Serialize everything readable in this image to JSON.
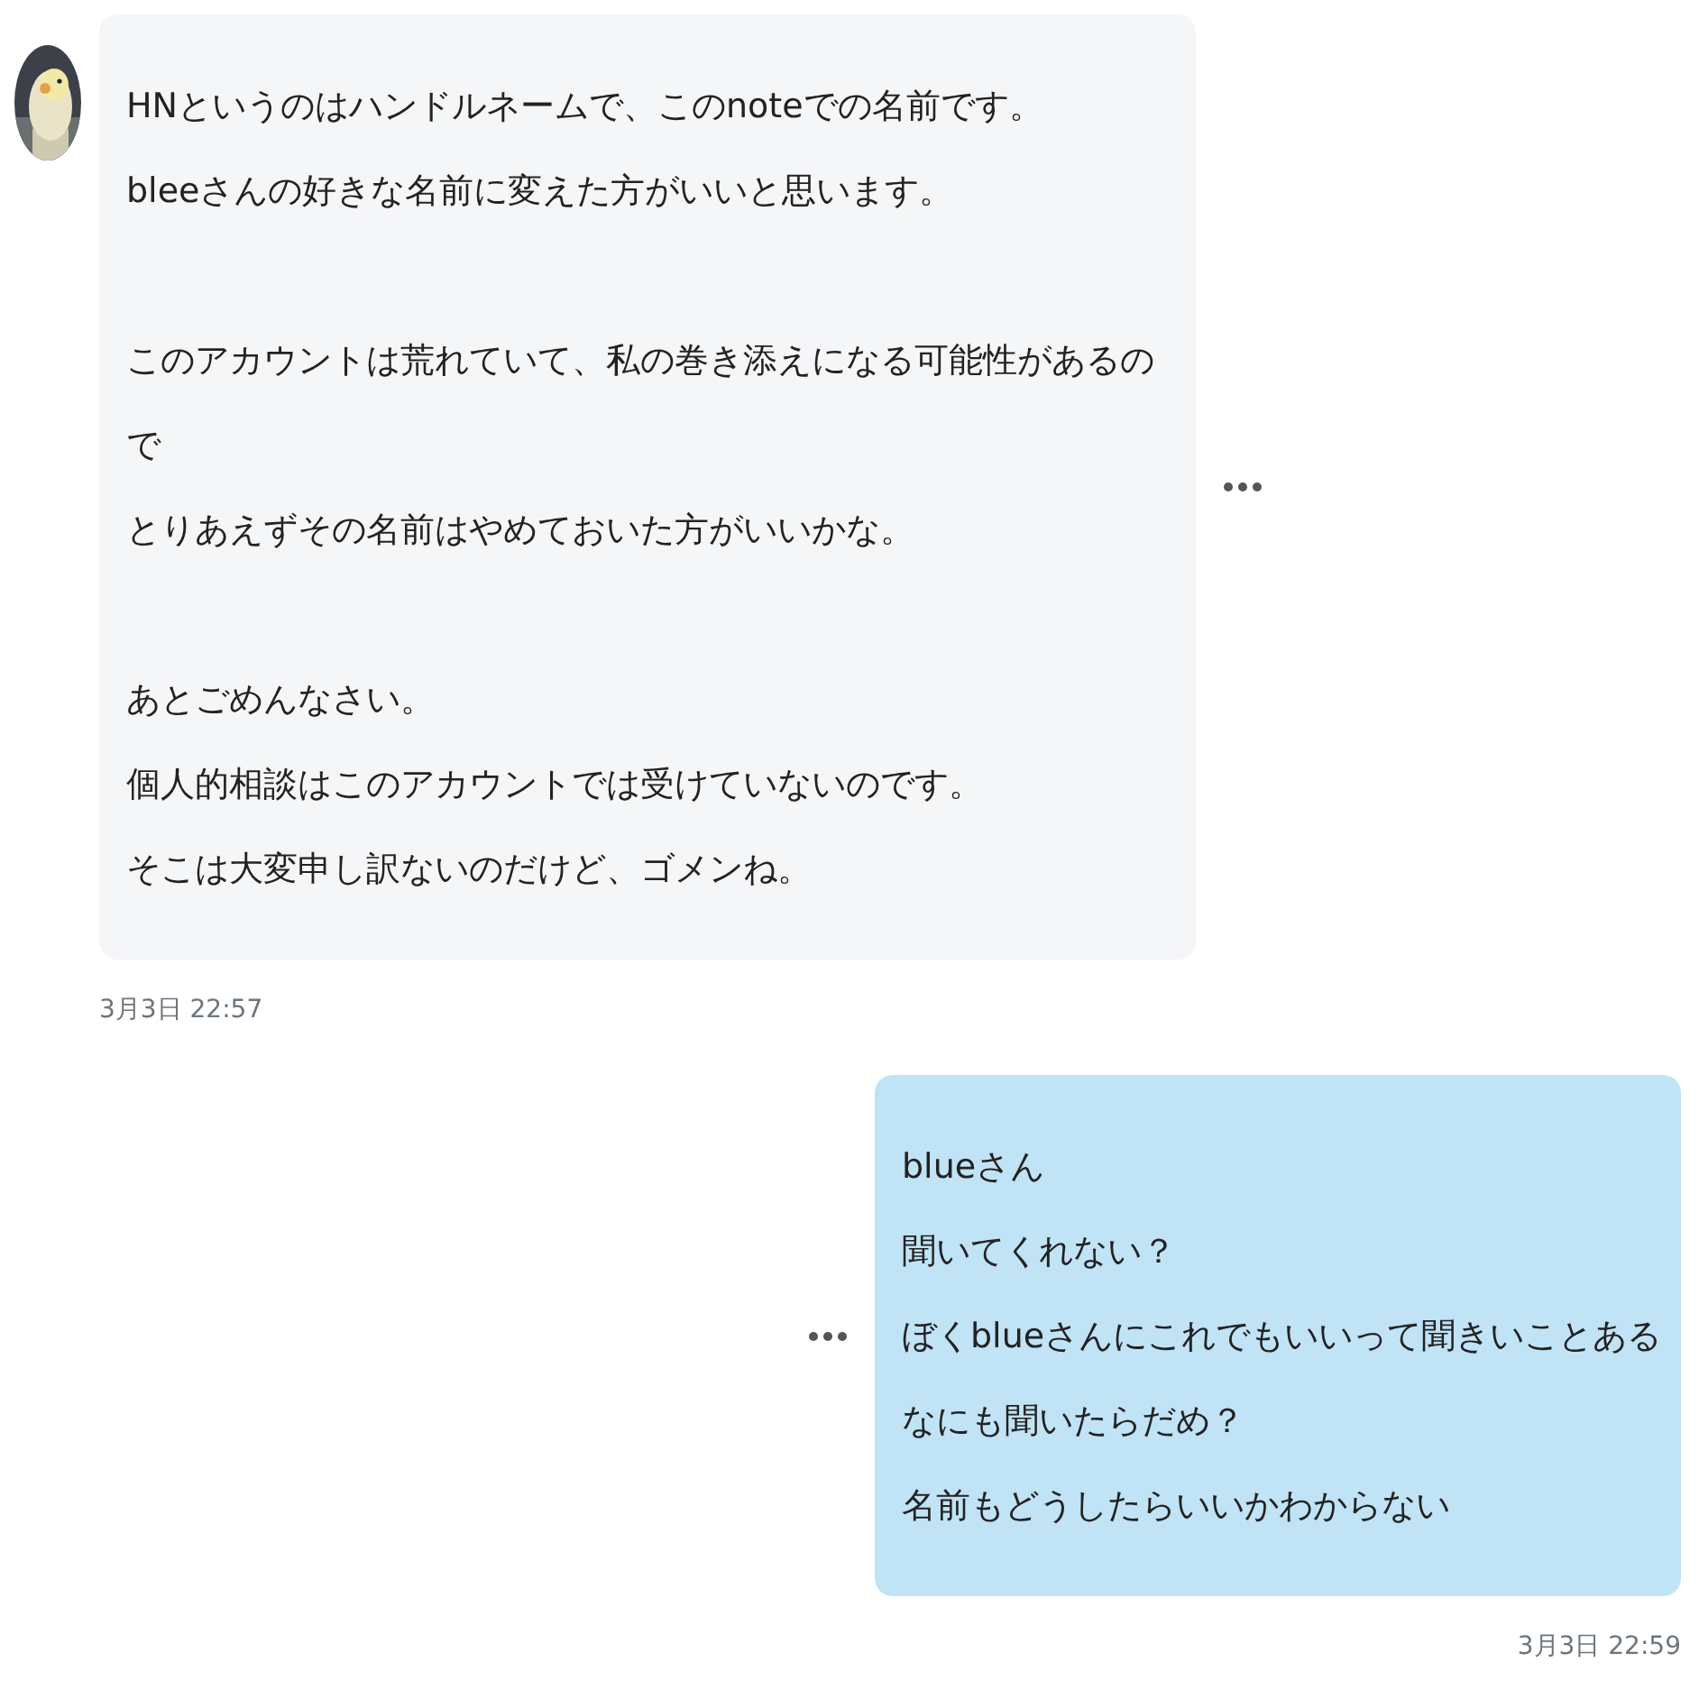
{
  "messages": [
    {
      "kind": "received",
      "paragraphs": [
        [
          "HNというのはハンドルネームで、このnoteでの名前です。",
          "bleeさんの好きな名前に変えた方がいいと思います。"
        ],
        [
          "このアカウントは荒れていて、私の巻き添えになる可能性があるので",
          "とりあえずその名前はやめておいた方がいいかな。"
        ],
        [
          "あとごめんなさい。",
          "個人的相談はこのアカウントでは受けていないのです。",
          "そこは大変申し訳ないのだけど、ゴメンね。"
        ]
      ],
      "time": "3月3日 22:57"
    },
    {
      "kind": "sent",
      "paragraphs": [
        [
          "blueさん",
          "聞いてくれない？",
          "ぼくblueさんにこれでもいいって聞きいことある",
          "なにも聞いたらだめ？",
          "名前もどうしたらいいかわからない"
        ]
      ],
      "time": "3月3日 22:59"
    }
  ]
}
